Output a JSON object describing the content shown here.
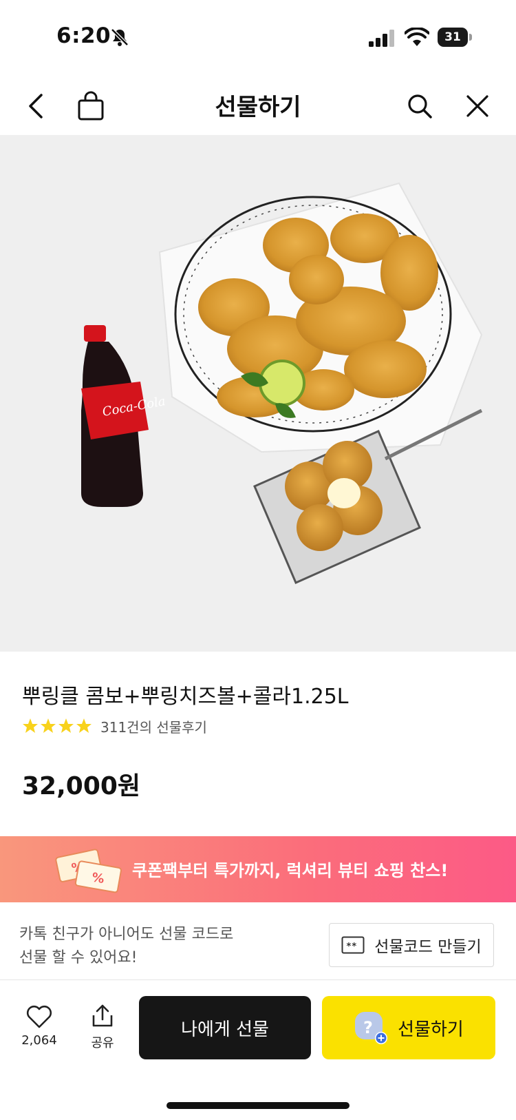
{
  "status_bar": {
    "time": "6:20",
    "battery": "31"
  },
  "nav": {
    "title": "선물하기"
  },
  "product": {
    "title": "뿌링클 콤보+뿌링치즈볼+콜라1.25L",
    "rating_stars": 4,
    "review_text": "311건의 선물후기",
    "price": "32,000원"
  },
  "promo": {
    "text": "쿠폰팩부터 특가까지, 럭셔리 뷰티 쇼핑 찬스!"
  },
  "gift_code": {
    "description_line1": "카톡 친구가 아니어도 선물 코드로",
    "description_line2": "선물 할 수 있어요!",
    "button_label": "선물코드 만들기"
  },
  "bottom_bar": {
    "like_count": "2,064",
    "share_label": "공유",
    "gift_self_label": "나에게 선물",
    "gift_label": "선물하기"
  },
  "colors": {
    "accent_yellow": "#fae100",
    "dark_button": "#161616",
    "star": "#f8d21c"
  }
}
